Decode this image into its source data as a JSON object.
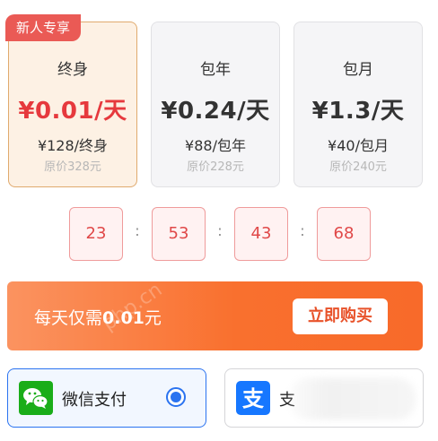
{
  "promo_badge": "新人专享",
  "plans": [
    {
      "name": "终身",
      "price": "¥0.01/天",
      "sub": "¥128/终身",
      "original": "原价328元",
      "selected": true
    },
    {
      "name": "包年",
      "price": "¥0.24/天",
      "sub": "¥88/包年",
      "original": "原价228元",
      "selected": false
    },
    {
      "name": "包月",
      "price": "¥1.3/天",
      "sub": "¥40/包月",
      "original": "原价240元",
      "selected": false
    }
  ],
  "countdown": [
    "23",
    "53",
    "43",
    "68"
  ],
  "countdown_separator": ":",
  "buy_bar": {
    "prefix": "每天仅需",
    "amount": "0.01",
    "unit": "元",
    "button": "立即购买"
  },
  "payment": {
    "wechat": {
      "label": "微信支付",
      "icon": "wechat-pay-icon",
      "color": "#1aad19",
      "selected": true
    },
    "alipay": {
      "label": "支",
      "icon": "alipay-icon",
      "color": "#1677ff",
      "selected": false
    }
  },
  "colors": {
    "accent": "#e6393d",
    "buy_gradient_start": "#fb9360",
    "buy_gradient_end": "#f86a2a",
    "selection_blue": "#2b73f0"
  },
  "watermark": "php.cn"
}
